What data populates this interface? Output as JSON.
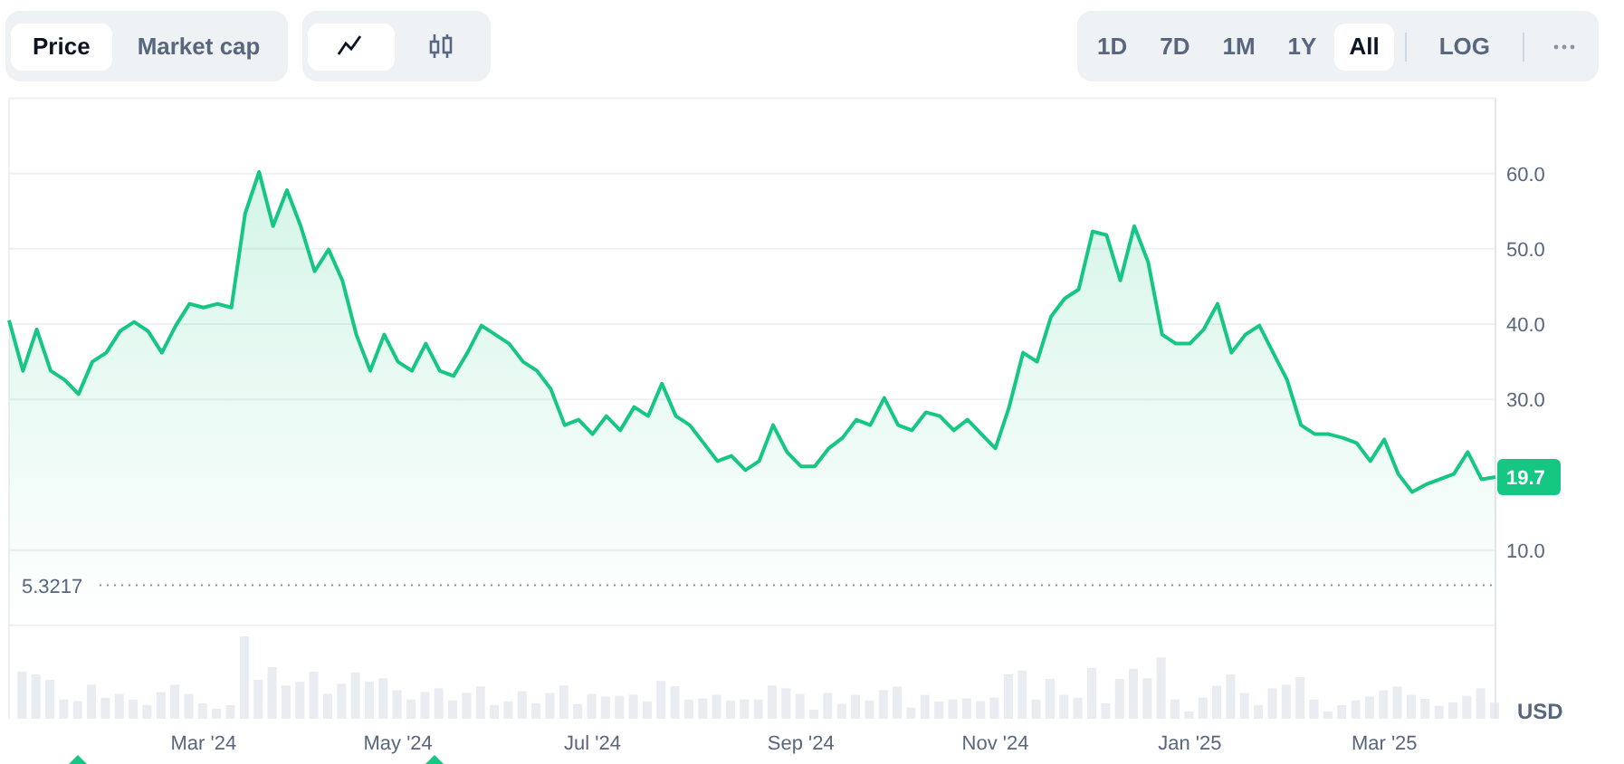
{
  "metric_tabs": [
    {
      "label": "Price",
      "selected": true
    },
    {
      "label": "Market cap",
      "selected": false
    }
  ],
  "chart_types": [
    {
      "kind": "line",
      "selected": true
    },
    {
      "kind": "candles",
      "selected": false
    }
  ],
  "ranges": [
    {
      "label": "1D",
      "selected": false
    },
    {
      "label": "7D",
      "selected": false
    },
    {
      "label": "1M",
      "selected": false
    },
    {
      "label": "1Y",
      "selected": false
    },
    {
      "label": "All",
      "selected": true
    }
  ],
  "scale_button": {
    "label": "LOG",
    "selected": false
  },
  "chart": {
    "current_price": "19.7",
    "low_price": "5.3217",
    "currency": "USD",
    "chart_data": {
      "type": "area",
      "ylim": [
        -12.4,
        70
      ],
      "grid": true,
      "categories": [
        null,
        null,
        null,
        null,
        null,
        null,
        null,
        null,
        null,
        null,
        null,
        null,
        null,
        null,
        "Mar '24",
        null,
        null,
        null,
        null,
        null,
        null,
        null,
        null,
        null,
        null,
        null,
        null,
        null,
        "May '24",
        null,
        null,
        null,
        null,
        null,
        null,
        null,
        null,
        null,
        null,
        null,
        null,
        null,
        "Jul '24",
        null,
        null,
        null,
        null,
        null,
        null,
        null,
        null,
        null,
        null,
        null,
        null,
        null,
        null,
        "Sep '24",
        null,
        null,
        null,
        null,
        null,
        null,
        null,
        null,
        null,
        null,
        null,
        null,
        null,
        "Nov '24",
        null,
        null,
        null,
        null,
        null,
        null,
        null,
        null,
        null,
        null,
        null,
        null,
        null,
        "Jan '25",
        null,
        null,
        null,
        null,
        null,
        null,
        null,
        null,
        null,
        null,
        null,
        null,
        null,
        "Mar '25",
        null,
        null,
        null,
        null,
        null,
        null,
        null,
        null
      ],
      "yticks": [
        {
          "value": 10,
          "label": "10.0"
        },
        {
          "value": 30,
          "label": "30.0"
        },
        {
          "value": 40,
          "label": "40.0"
        },
        {
          "value": 50,
          "label": "50.0"
        },
        {
          "value": 60,
          "label": "60.0"
        }
      ],
      "series": [
        {
          "color": "#16c784",
          "values": [
            40.5,
            33.8,
            39.3,
            33.8,
            32.6,
            30.7,
            35.0,
            36.2,
            39.1,
            40.3,
            39.1,
            36.2,
            39.8,
            42.7,
            42.2,
            42.7,
            42.2,
            54.7,
            60.2,
            53.0,
            57.8,
            53.0,
            47.0,
            49.9,
            45.8,
            38.6,
            33.8,
            38.6,
            35.0,
            33.8,
            37.4,
            33.8,
            33.1,
            36.2,
            39.8,
            38.6,
            37.4,
            35.0,
            33.8,
            31.4,
            26.6,
            27.3,
            25.4,
            27.8,
            25.9,
            29.0,
            27.8,
            32.1,
            27.8,
            26.6,
            24.2,
            21.8,
            22.5,
            20.6,
            21.8,
            26.6,
            23.0,
            21.1,
            21.1,
            23.5,
            24.9,
            27.3,
            26.6,
            30.2,
            26.6,
            25.9,
            28.3,
            27.8,
            25.9,
            27.3,
            25.4,
            23.5,
            29.0,
            36.2,
            35.0,
            41.0,
            43.4,
            44.6,
            52.3,
            51.8,
            45.8,
            53.0,
            48.2,
            38.6,
            37.4,
            37.4,
            39.3,
            42.7,
            36.2,
            38.6,
            39.8,
            36.2,
            32.6,
            26.6,
            25.4,
            25.4,
            24.9,
            24.2,
            21.8,
            24.7,
            20.1,
            17.7,
            18.7,
            19.4,
            20.1,
            23.0,
            19.4,
            19.7
          ]
        }
      ]
    }
  }
}
